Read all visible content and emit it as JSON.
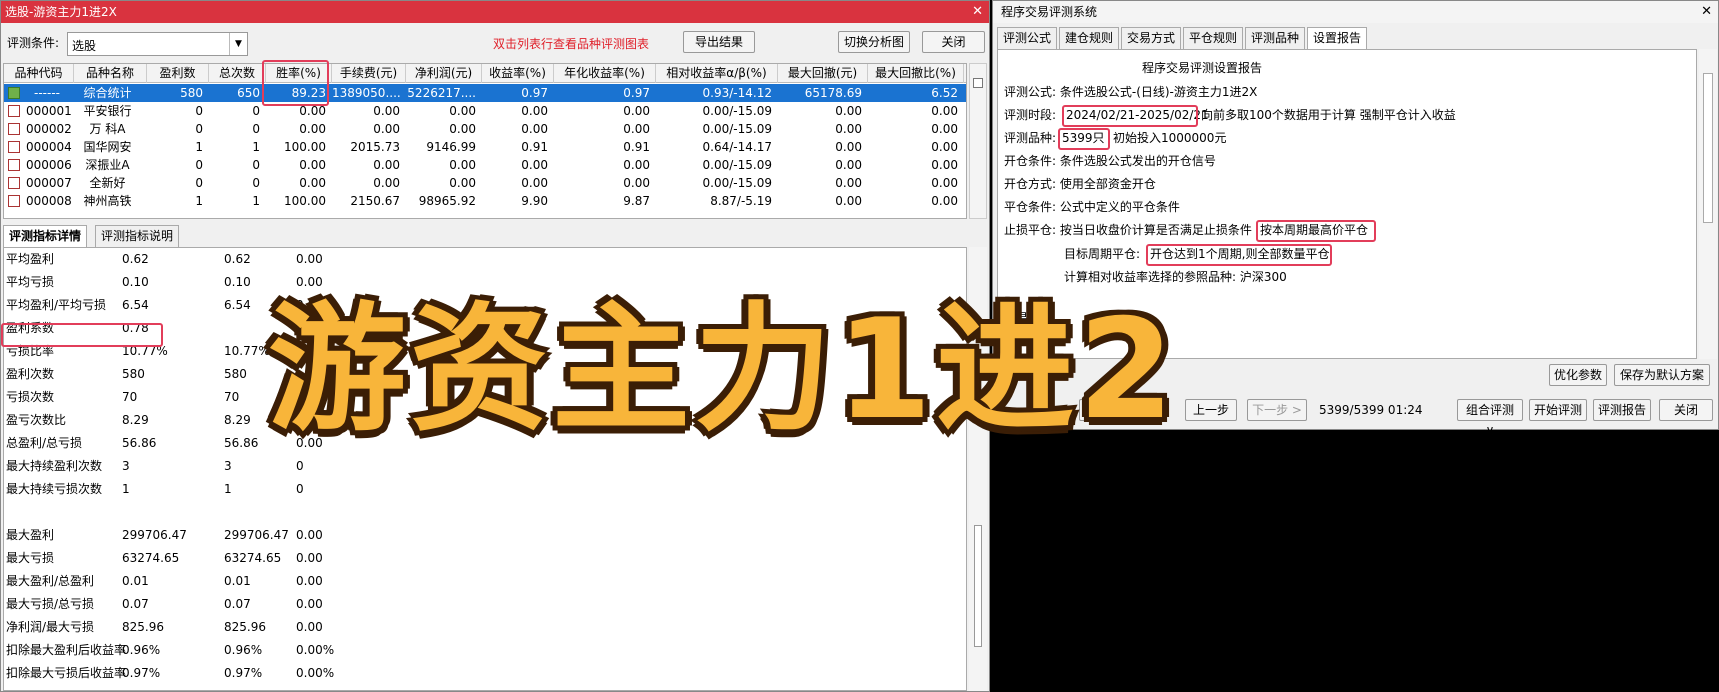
{
  "left_window": {
    "title": "选股-游资主力1进2X",
    "condition_label": "评测条件:",
    "condition_value": "选股",
    "hint": "双击列表行查看品种评测图表",
    "export_btn": "导出结果",
    "switch_btn": "切换分析图",
    "close_btn": "关闭",
    "columns": [
      "品种代码",
      "品种名称",
      "盈利数",
      "总次数",
      "胜率(%)",
      "手续费(元)",
      "净利润(元)",
      "收益率(%)",
      "年化收益率(%)",
      "相对收益率α/β(%)",
      "最大回撤(元)",
      "最大回撤比(%)"
    ],
    "rows": [
      [
        "------",
        "综合统计",
        "580",
        "650",
        "89.23",
        "1389050....",
        "5226217....",
        "0.97",
        "0.97",
        "0.93/-14.12",
        "65178.69",
        "6.52"
      ],
      [
        "000001",
        "平安银行",
        "0",
        "0",
        "0.00",
        "0.00",
        "0.00",
        "0.00",
        "0.00",
        "0.00/-15.09",
        "0.00",
        "0.00"
      ],
      [
        "000002",
        "万 科A",
        "0",
        "0",
        "0.00",
        "0.00",
        "0.00",
        "0.00",
        "0.00",
        "0.00/-15.09",
        "0.00",
        "0.00"
      ],
      [
        "000004",
        "国华网安",
        "1",
        "1",
        "100.00",
        "2015.73",
        "9146.99",
        "0.91",
        "0.91",
        "0.64/-14.17",
        "0.00",
        "0.00"
      ],
      [
        "000006",
        "深振业A",
        "0",
        "0",
        "0.00",
        "0.00",
        "0.00",
        "0.00",
        "0.00",
        "0.00/-15.09",
        "0.00",
        "0.00"
      ],
      [
        "000007",
        "全新好",
        "0",
        "0",
        "0.00",
        "0.00",
        "0.00",
        "0.00",
        "0.00",
        "0.00/-15.09",
        "0.00",
        "0.00"
      ],
      [
        "000008",
        "神州高铁",
        "1",
        "1",
        "100.00",
        "2150.67",
        "98965.92",
        "9.90",
        "9.87",
        "8.87/-5.19",
        "0.00",
        "0.00"
      ]
    ],
    "detail_tabs": [
      "评测指标详情",
      "评测指标说明"
    ],
    "stats": [
      [
        "平均盈利",
        "0.62",
        "0.62",
        "0.00"
      ],
      [
        "平均亏损",
        "0.10",
        "0.10",
        "0.00"
      ],
      [
        "平均盈利/平均亏损",
        "6.54",
        "6.54",
        "0.00"
      ],
      [
        "盈利系数",
        "0.78",
        "",
        ""
      ],
      [
        "亏损比率",
        "10.77%",
        "10.77%",
        ""
      ],
      [
        "盈利次数",
        "580",
        "580",
        ""
      ],
      [
        "亏损次数",
        "70",
        "70",
        "0"
      ],
      [
        "盈亏次数比",
        "8.29",
        "8.29",
        ""
      ],
      [
        "总盈利/总亏损",
        "56.86",
        "56.86",
        "0.00"
      ],
      [
        "最大持续盈利次数",
        "3",
        "3",
        "0"
      ],
      [
        "最大持续亏损次数",
        "1",
        "1",
        "0"
      ],
      [
        "",
        "",
        "",
        ""
      ],
      [
        "最大盈利",
        "299706.47",
        "299706.47",
        "0.00"
      ],
      [
        "最大亏损",
        "63274.65",
        "63274.65",
        "0.00"
      ],
      [
        "最大盈利/总盈利",
        "0.01",
        "0.01",
        "0.00"
      ],
      [
        "最大亏损/总亏损",
        "0.07",
        "0.07",
        "0.00"
      ],
      [
        "净利润/最大亏损",
        "825.96",
        "825.96",
        "0.00"
      ],
      [
        "扣除最大盈利后收益率",
        "0.96%",
        "0.96%",
        "0.00%"
      ],
      [
        "扣除最大亏损后收益率",
        "0.97%",
        "0.97%",
        "0.00%"
      ]
    ]
  },
  "right_window": {
    "title": "程序交易评测系统",
    "tabs": [
      "评测公式",
      "建仓规则",
      "交易方式",
      "平仓规则",
      "评测品种",
      "设置报告"
    ],
    "report_title": "程序交易评测设置报告",
    "formula": "评测公式: 条件选股公式-(日线)-游资主力1进2X",
    "period_label": "评测时段:",
    "period_value": "2024/02/21-2025/02/21",
    "period_note": "向前多取100个数据用于计算 强制平仓计入收益",
    "variety_label": "评测品种:",
    "variety_value": "5399只",
    "variety_note": "初始投入1000000元",
    "open_cond": "开仓条件: 条件选股公式发出的开仓信号",
    "open_method": "开仓方式: 使用全部资金开仓",
    "close_cond": "平仓条件: 公式中定义的平仓条件",
    "stop_label": "止损平仓: 按当日收盘价计算是否满足止损条件",
    "stop_value": "按本周期最高价平仓",
    "target_label": "目标周期平仓:",
    "target_value": "开仓达到1个周期,则全部数量平仓",
    "bench": "计算相对收益率选择的参照品种: 沪深300",
    "trade_partial": "交易",
    "trade_partial2": "空头评",
    "optimize_btn": "优化参数",
    "save_btn": "保存为默认方案",
    "prev_btn": "上一步",
    "next_btn": "下一步 >",
    "progress": "5399/5399  01:24",
    "combo_btn": "组合评测∨",
    "start_btn": "开始评测",
    "report_btn": "评测报告",
    "close_btn": "关闭",
    "left_btn_partial": "案"
  },
  "overlay_text": "游资主力1进2"
}
